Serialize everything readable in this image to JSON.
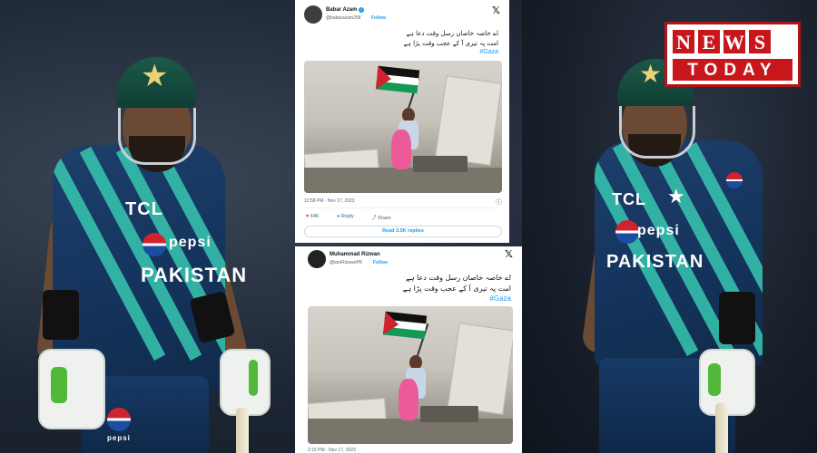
{
  "logo": {
    "letters": [
      "N",
      "E",
      "W",
      "S"
    ],
    "bottom": "TODAY",
    "brand_color": "#c8161d"
  },
  "players": {
    "left": {
      "sponsor_top": "TCL",
      "sponsor_mid": "pepsi",
      "country": "PAKISTAN",
      "trouser_sponsor": "pepsi"
    },
    "right": {
      "sponsor_top": "TCL",
      "sponsor_mid": "pepsi",
      "country": "PAKISTAN"
    }
  },
  "tweets": [
    {
      "name": "Babar Azam",
      "handle": "@babarazam258",
      "follow": "Follow",
      "verified": true,
      "text_line1": "اے خاصہ خاصان رسل وقت دعا ہے",
      "text_line2": "امت پہ تیری آ کے عجب وقت پڑا ہے",
      "hashtag": "#Gaza",
      "meta": "12:58 PM · Nov 17, 2023",
      "likes": "64K",
      "reply_label": "Reply",
      "share_label": "Share",
      "read_replies": "Read 3.5K replies"
    },
    {
      "name": "Muhammad Rizwan",
      "handle": "@iamRizwanPK",
      "follow": "Follow",
      "verified": false,
      "text_line1": "اے خاصہ خاصان رسل وقت دعا ہے",
      "text_line2": "امت پہ تیری آ کے عجب وقت پڑا ہے",
      "hashtag": "#Gaza",
      "meta": "2:15 PM · Nov 17, 2023"
    }
  ],
  "icons": {
    "x_logo": "x-logo-icon",
    "heart": "heart-icon",
    "reply": "reply-icon",
    "share": "share-icon",
    "info": "info-icon"
  },
  "glyphs": {
    "star": "★",
    "x": "𝕏",
    "check": "✓",
    "heart": "♥",
    "reply": "●",
    "share": "⤴",
    "info": "ⓘ"
  },
  "colors": {
    "twitter_blue": "#1d9bf0",
    "jersey_navy": "#15355e",
    "jersey_stripe": "#37c7b0",
    "helmet_green": "#0f3e33"
  }
}
